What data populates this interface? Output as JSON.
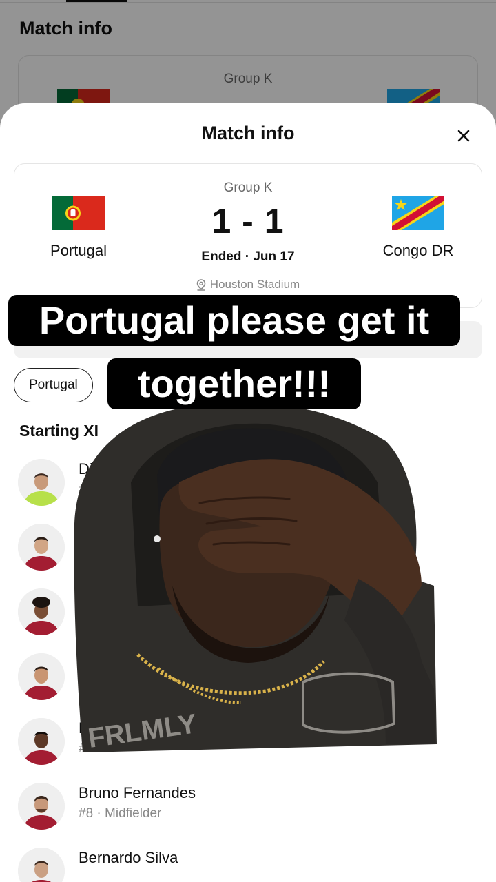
{
  "background": {
    "title": "Match info",
    "group": "Group K"
  },
  "sheet": {
    "title": "Match info",
    "close_icon": "close-icon",
    "match": {
      "group": "Group K",
      "home_team": "Portugal",
      "away_team": "Congo DR",
      "score": "1 - 1",
      "status": "Ended · Jun 17",
      "venue": "Houston Stadium",
      "venue_icon": "location-pin-icon"
    },
    "team_chip": "Portugal",
    "lineup_title": "Starting XI",
    "players": [
      {
        "name": "Diog",
        "meta": "#1"
      },
      {
        "name": "",
        "meta": ""
      },
      {
        "name": "",
        "meta": ""
      },
      {
        "name": "",
        "meta": "#"
      },
      {
        "name": "N",
        "meta": "#"
      },
      {
        "name": "Bruno Fernandes",
        "meta": "#8 · Midfielder"
      },
      {
        "name": "Bernardo Silva",
        "meta": ""
      }
    ]
  },
  "overlay": {
    "caption_line1": "Portugal please get it",
    "caption_line2": "together!!!",
    "shirt_text": "FRLMLY"
  },
  "colors": {
    "portugal_green": "#046a38",
    "portugal_red": "#da291c",
    "congo_blue": "#1fa5e6",
    "congo_red": "#d21034",
    "congo_yellow": "#f7d618",
    "jersey_red": "#a31d32",
    "keeper_green": "#b7e04a"
  }
}
